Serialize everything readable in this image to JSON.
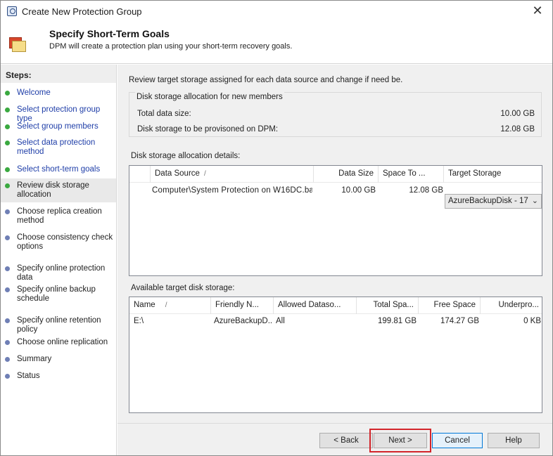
{
  "window": {
    "title": "Create New Protection Group",
    "close_glyph": "✕"
  },
  "header": {
    "title": "Specify Short-Term Goals",
    "subtitle": "DPM will create a protection plan using your short-term recovery goals."
  },
  "steps": {
    "title": "Steps:",
    "items": [
      {
        "label": "Welcome",
        "state": "done"
      },
      {
        "label": "Select protection group type",
        "state": "done"
      },
      {
        "label": "Select group members",
        "state": "done"
      },
      {
        "label": "Select data protection method",
        "state": "done"
      },
      {
        "label": "Select short-term goals",
        "state": "done"
      },
      {
        "label": "Review disk storage allocation",
        "state": "current"
      },
      {
        "label": "Choose replica creation method",
        "state": "pending"
      },
      {
        "label": "Choose consistency check options",
        "state": "pending"
      },
      {
        "label": "Specify online protection data",
        "state": "pending"
      },
      {
        "label": "Specify online backup schedule",
        "state": "pending"
      },
      {
        "label": "Specify online retention policy",
        "state": "pending"
      },
      {
        "label": "Choose online replication",
        "state": "pending"
      },
      {
        "label": "Summary",
        "state": "pending"
      },
      {
        "label": "Status",
        "state": "pending"
      }
    ]
  },
  "main": {
    "intro": "Review target storage assigned for each data source and change if need be.",
    "new_members": {
      "legend": "Disk storage allocation for new members",
      "total_label": "Total data size:",
      "total_value": "10.00 GB",
      "provision_label": "Disk storage to be provisoned on DPM:",
      "provision_value": "12.08 GB"
    },
    "details": {
      "label": "Disk storage allocation details:",
      "columns": {
        "data_source": "Data Source",
        "data_size": "Data Size",
        "space_to": "Space To ...",
        "target_storage": "Target Storage"
      },
      "rows": [
        {
          "data_source": "Computer\\System Protection on W16DC.ba...",
          "data_size": "10.00 GB",
          "space_to": "12.08 GB",
          "target_storage": "AzureBackupDisk - 17"
        }
      ]
    },
    "available": {
      "label": "Available target disk storage:",
      "columns": {
        "name": "Name",
        "friendly_name": "Friendly N...",
        "allowed": "Allowed Dataso...",
        "total": "Total Spa...",
        "free": "Free Space",
        "underpro": "Underpro..."
      },
      "rows": [
        {
          "name": "E:\\",
          "friendly_name": "AzureBackupD...",
          "allowed": "All",
          "total": "199.81 GB",
          "free": "174.27 GB",
          "underpro": "0 KB"
        }
      ]
    }
  },
  "footer": {
    "back": "< Back",
    "next": "Next >",
    "cancel": "Cancel",
    "help": "Help"
  },
  "icons": {
    "sort": "sort-arrow-icon",
    "dropdown": "chevron-down-icon",
    "title": "dpm-app-icon",
    "header": "protection-group-icon",
    "close": "close-icon",
    "step": "step-bullet-icon"
  }
}
